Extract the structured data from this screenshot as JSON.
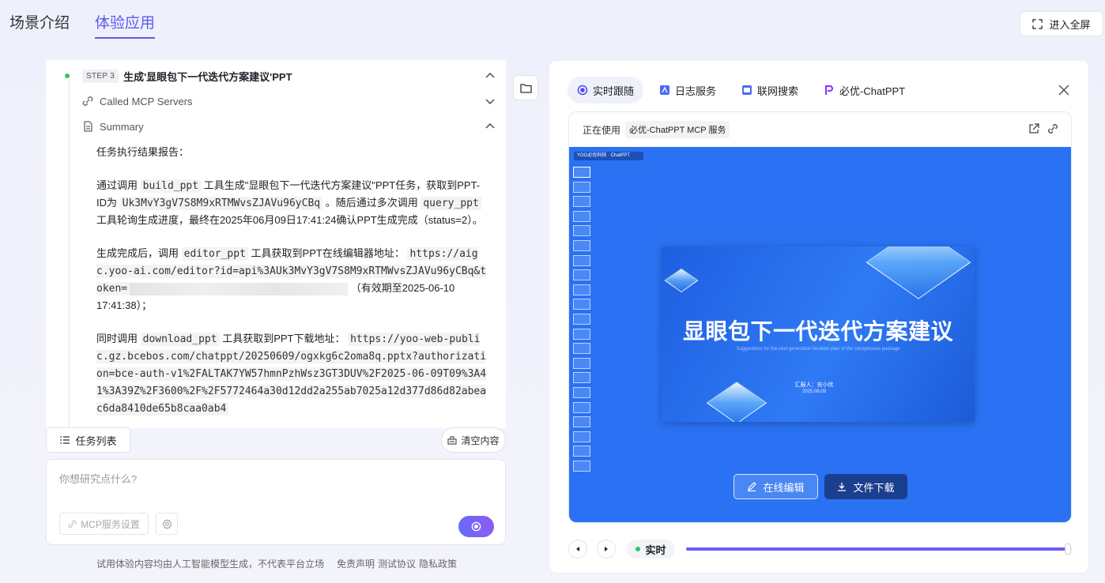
{
  "top_tabs": [
    {
      "label": "场景介绍",
      "active": false
    },
    {
      "label": "体验应用",
      "active": true
    }
  ],
  "fullscreen_label": "进入全屏",
  "step": {
    "tag": "STEP 3",
    "title": "生成'显眼包下一代迭代方案建议'PPT"
  },
  "called_mcp_label": "Called MCP Servers",
  "summary_label": "Summary",
  "summary": {
    "heading": "任务执行结果报告：",
    "p1_a": "通过调用",
    "p1_code1": "build_ppt",
    "p1_b": "工具生成\"显眼包下一代迭代方案建议\"PPT任务，获取到PPT-ID为",
    "p1_code2": "Uk3MvY3gV7S8M9xRTMWvsZJAVu96yCBq",
    "p1_c": "。随后通过多次调用",
    "p1_code3": "query_ppt",
    "p1_d": "工具轮询生成进度，最终在2025年06月09日17:41:24确认PPT生成完成（status=2）。",
    "p2_a": "生成完成后，调用",
    "p2_code1": "editor_ppt",
    "p2_b": "工具获取到PPT在线编辑器地址：",
    "p2_code2": "https://aigc.yoo-ai.com/editor?id=api%3AUk3MvY3gV7S8M9xRTMWvsZJAVu96yCBq&token=",
    "p2_c": "（有效期至2025-06-10 17:41:38）；",
    "p3_a": "同时调用",
    "p3_code1": "download_ppt",
    "p3_b": "工具获取到PPT下载地址：",
    "p3_code2": "https://yoo-web-public.gz.bcebos.com/chatppt/20250609/ogxkg6c2oma8q.pptx?authorization=bce-auth-v1%2FALTAK7YW57hmnPzhWsz3GT3DUV%2F2025-06-09T09%3A41%3A39Z%2F3600%2F%2F5772464a30d12dd2a255ab7025a12d377d86d82abeac6da8410de65b8caa0ab4"
  },
  "task_list_label": "任务列表",
  "clear_label": "清空内容",
  "input": {
    "placeholder": "你想研究点什么?",
    "mcp_settings_label": "MCP服务设置"
  },
  "disclaimer": {
    "text": "试用体验内容均由人工智能模型生成，不代表平台立场",
    "links": [
      "免责声明",
      "测试协议",
      "隐私政策"
    ]
  },
  "right": {
    "tabs": [
      {
        "label": "实时跟随",
        "icon": "target-icon",
        "active": true
      },
      {
        "label": "日志服务",
        "icon": "log-icon",
        "active": false
      },
      {
        "label": "联网搜索",
        "icon": "browser-icon",
        "active": false
      },
      {
        "label": "必优-ChatPPT",
        "icon": "chatppt-logo-icon",
        "active": false
      }
    ],
    "using_label": "正在使用",
    "service_name": "必优-ChatPPT MCP 服务",
    "stage_logo_text": "YOO必优科技 · ChatPPT",
    "slide": {
      "title": "显眼包下一代迭代方案建议",
      "subtitle": "Suggestions for the next generation iteration plan of the conspicuous package",
      "reporter": "汇报人：充小优",
      "date": "2025.06.09"
    },
    "edit_label": "在线编辑",
    "download_label": "文件下载",
    "live_label": "实时",
    "progress": 0.99,
    "thumb_count": 21
  },
  "colors": {
    "accent": "#5b5bf0",
    "stage_blue": "#2a72f3",
    "status_green": "#35c26b"
  }
}
